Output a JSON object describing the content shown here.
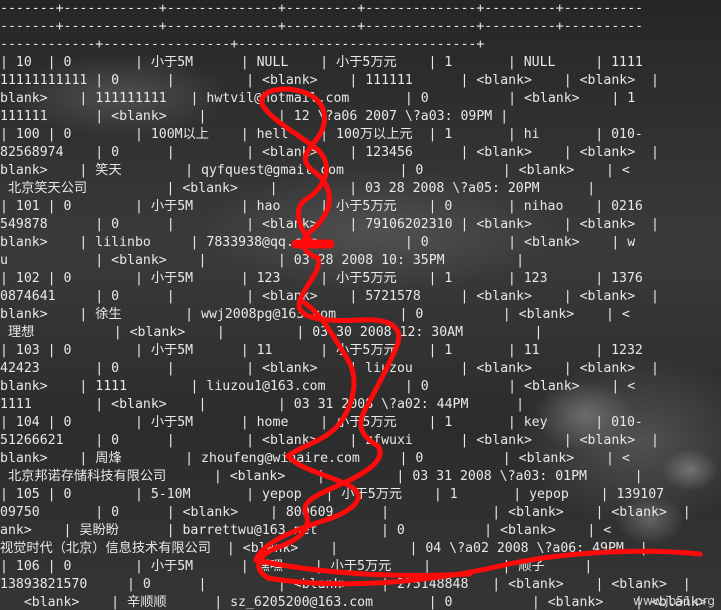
{
  "terminal": {
    "lines": [
      "-------+------------+--------------+---------+--------------+---------+----------",
      "-------+------------+--------------+---------+--------------+---------+----------",
      "------------+----------------+------------------------------+",
      "| 10  | 0        | 小于5M      | NULL    | 小于5万元    | 1       | NULL     | 1111",
      "11111111111 | 0      |         | <blank>    | 111111      | <blank>    | <blank>  |",
      "blank>    | 111111111   | hwtvil@hotmail.com       | 0          | <blank>    | 1",
      "111111      | <blank>    |         | 12 \\?a06 2007 \\?a03: 09PM |",
      "| 100 | 0        | 100M以上    | hell    | 100万以上元  | 1       | hi       | 010-",
      "82568974    | 0      |         | <blank>    | 123456      | <blank>    | <blank>  |",
      "blank>    | 笑天        | qyfquest@gmail.com       | 0          | <blank>    | <",
      " 北京笑天公司          | <blank>    |         | 03 28 2008 \\?a05: 20PM      |",
      "| 101 | 0        | 小于5M      | hao     | 小于5万元    | 0       | nihao    | 0216",
      "549878      | 0      |         | <blank>    | 79106202310 | <blank>    | <blank>  |",
      "blank>    | lilinbo     | 7833938@qq.com           | 0          | <blank>    | w",
      "u           | <blank>    |         | 03 28 2008 10: 35PM         |",
      "| 102 | 0        | 小于5M      | 123     | 小于5万元    | 1       | 123      | 1376",
      "0874641     | 0      |         | <blank>    | 5721578     | <blank>    | <blank>  |",
      "blank>    | 徐生        | wwj2008pg@163.com        | 0          | <blank>    | <",
      " 理想          | <blank>    |         | 03 30 2008 12: 30AM         |",
      "| 103 | 0        | 小于5M      | 11      | 小于5万元    | 1       | 11       | 1232",
      "42423       | 0      |         | <blank>    | liuzou      | <blank>    | <blank>  |",
      "blank>    | 1111        | liuzou1@163.com          | 0          | <blank>    | <",
      "1111        | <blank>    |         | 03 31 2008 \\?a02: 44PM      |",
      "| 104 | 0        | 小于5M      | home    | 小于5万元    | 1       | key      | 010-",
      "51266621    | 0      |         | <blank>    | zfwuxi      | <blank>    | <blank>  |",
      "blank>    | 周烽        | zhoufeng@winaire.com     | 0          | <blank>    | <",
      " 北京邦诺存储科技有限公司      | <blank>    |         | 03 31 2008 \\?a03: 01PM      |",
      "| 105 | 0        | 5-10M       | yepop   | 小于5万元    | 1       | yepop    | 139107",
      "09750       | 0      | <blank>    | 800609      |             | <blank>    | <blank>  |",
      "ank>    | 吴盼盼      | barrettwu@163.net        | 0          | <blank>    | <",
      "视觉时代（北京）信息技术有限公司  | <blank>    |         | 04 \\?a02 2008 \\?a06: 49PM  |",
      "| 106 | 0        | 小于5M      | 嘿嘿    | 小于5万元    |         | 顺子     |",
      "13893821570     | 0      |         | <blank>    | 275148848   | <blank>    | <blank>  |",
      "   <blank>    | 辛顺顺      | sz_6205200@163.com       | 0          | <blank>    | <blank>"
    ]
  },
  "watermark": "www.jb51.org",
  "annotation": {
    "stroke_color": "#ff0a0a"
  }
}
